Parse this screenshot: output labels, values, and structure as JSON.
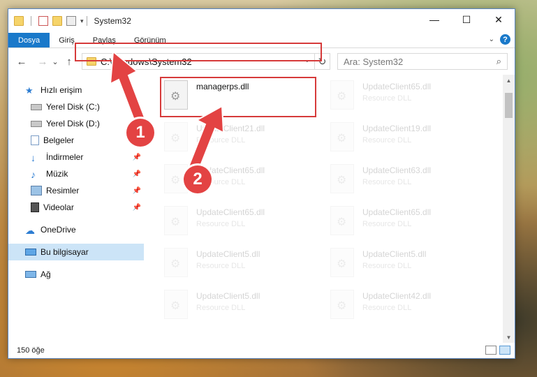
{
  "window": {
    "title": "System32",
    "controls": {
      "minimize": "—",
      "maximize": "☐",
      "close": "✕"
    }
  },
  "ribbon": {
    "tabs": [
      {
        "label": "Dosya",
        "active": true
      },
      {
        "label": "Giriş"
      },
      {
        "label": "Paylaş"
      },
      {
        "label": "Görünüm"
      }
    ],
    "expand_icon": "chevron-down-icon",
    "help_label": "?"
  },
  "nav": {
    "back": "←",
    "forward": "→",
    "recent": "⌄",
    "up": "↑",
    "address": "C:\\Windows\\System32",
    "refresh": "↻",
    "search_placeholder": "Ara: System32",
    "search_icon": "⌕"
  },
  "sidebar": {
    "items": [
      {
        "label": "Hızlı erişim",
        "icon": "star-icon",
        "color": "#2d7dd2"
      },
      {
        "label": "Yerel Disk (C:)",
        "icon": "drive-icon",
        "pinned": true
      },
      {
        "label": "Yerel Disk (D:)",
        "icon": "drive-icon"
      },
      {
        "label": "Belgeler",
        "icon": "document-icon",
        "pinned": true
      },
      {
        "label": "İndirmeler",
        "icon": "download-icon",
        "pinned": true
      },
      {
        "label": "Müzik",
        "icon": "music-icon",
        "pinned": true
      },
      {
        "label": "Resimler",
        "icon": "pictures-icon",
        "pinned": true
      },
      {
        "label": "Videolar",
        "icon": "video-icon",
        "pinned": true
      },
      {
        "label": "OneDrive",
        "icon": "cloud-icon"
      },
      {
        "label": "Bu bilgisayar",
        "icon": "computer-icon",
        "selected": true
      },
      {
        "label": "Ağ",
        "icon": "network-icon"
      }
    ]
  },
  "files": [
    {
      "name": "managerps.dll",
      "type": "",
      "highlighted": true
    },
    {
      "name": "UpdateClient65.dll",
      "type": "Resource DLL"
    },
    {
      "name": "UpdateClient21.dll",
      "type": "Resource DLL"
    },
    {
      "name": "UpdateClient19.dll",
      "type": "Resource DLL"
    },
    {
      "name": "UpdateClient65.dll",
      "type": "Resource DLL"
    },
    {
      "name": "UpdateClient63.dll",
      "type": "Resource DLL"
    },
    {
      "name": "UpdateClient65.dll",
      "type": "Resource DLL"
    },
    {
      "name": "UpdateClient65.dll",
      "type": "Resource DLL"
    },
    {
      "name": "UpdateClient5.dll",
      "type": "Resource DLL"
    },
    {
      "name": "UpdateClient5.dll",
      "type": "Resource DLL"
    },
    {
      "name": "UpdateClient5.dll",
      "type": "Resource DLL"
    },
    {
      "name": "UpdateClient42.dll",
      "type": "Resource DLL"
    }
  ],
  "status": {
    "item_count": "150 öğe"
  },
  "callouts": [
    "1",
    "2"
  ],
  "colors": {
    "accent": "#1979ca",
    "annotation_red": "#e34343"
  }
}
